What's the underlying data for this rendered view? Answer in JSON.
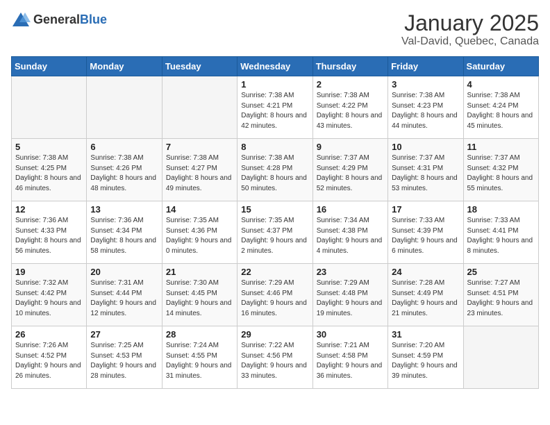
{
  "header": {
    "logo_general": "General",
    "logo_blue": "Blue",
    "month_title": "January 2025",
    "location": "Val-David, Quebec, Canada"
  },
  "days_of_week": [
    "Sunday",
    "Monday",
    "Tuesday",
    "Wednesday",
    "Thursday",
    "Friday",
    "Saturday"
  ],
  "weeks": [
    [
      {
        "day": "",
        "info": ""
      },
      {
        "day": "",
        "info": ""
      },
      {
        "day": "",
        "info": ""
      },
      {
        "day": "1",
        "info": "Sunrise: 7:38 AM\nSunset: 4:21 PM\nDaylight: 8 hours and 42 minutes."
      },
      {
        "day": "2",
        "info": "Sunrise: 7:38 AM\nSunset: 4:22 PM\nDaylight: 8 hours and 43 minutes."
      },
      {
        "day": "3",
        "info": "Sunrise: 7:38 AM\nSunset: 4:23 PM\nDaylight: 8 hours and 44 minutes."
      },
      {
        "day": "4",
        "info": "Sunrise: 7:38 AM\nSunset: 4:24 PM\nDaylight: 8 hours and 45 minutes."
      }
    ],
    [
      {
        "day": "5",
        "info": "Sunrise: 7:38 AM\nSunset: 4:25 PM\nDaylight: 8 hours and 46 minutes."
      },
      {
        "day": "6",
        "info": "Sunrise: 7:38 AM\nSunset: 4:26 PM\nDaylight: 8 hours and 48 minutes."
      },
      {
        "day": "7",
        "info": "Sunrise: 7:38 AM\nSunset: 4:27 PM\nDaylight: 8 hours and 49 minutes."
      },
      {
        "day": "8",
        "info": "Sunrise: 7:38 AM\nSunset: 4:28 PM\nDaylight: 8 hours and 50 minutes."
      },
      {
        "day": "9",
        "info": "Sunrise: 7:37 AM\nSunset: 4:29 PM\nDaylight: 8 hours and 52 minutes."
      },
      {
        "day": "10",
        "info": "Sunrise: 7:37 AM\nSunset: 4:31 PM\nDaylight: 8 hours and 53 minutes."
      },
      {
        "day": "11",
        "info": "Sunrise: 7:37 AM\nSunset: 4:32 PM\nDaylight: 8 hours and 55 minutes."
      }
    ],
    [
      {
        "day": "12",
        "info": "Sunrise: 7:36 AM\nSunset: 4:33 PM\nDaylight: 8 hours and 56 minutes."
      },
      {
        "day": "13",
        "info": "Sunrise: 7:36 AM\nSunset: 4:34 PM\nDaylight: 8 hours and 58 minutes."
      },
      {
        "day": "14",
        "info": "Sunrise: 7:35 AM\nSunset: 4:36 PM\nDaylight: 9 hours and 0 minutes."
      },
      {
        "day": "15",
        "info": "Sunrise: 7:35 AM\nSunset: 4:37 PM\nDaylight: 9 hours and 2 minutes."
      },
      {
        "day": "16",
        "info": "Sunrise: 7:34 AM\nSunset: 4:38 PM\nDaylight: 9 hours and 4 minutes."
      },
      {
        "day": "17",
        "info": "Sunrise: 7:33 AM\nSunset: 4:39 PM\nDaylight: 9 hours and 6 minutes."
      },
      {
        "day": "18",
        "info": "Sunrise: 7:33 AM\nSunset: 4:41 PM\nDaylight: 9 hours and 8 minutes."
      }
    ],
    [
      {
        "day": "19",
        "info": "Sunrise: 7:32 AM\nSunset: 4:42 PM\nDaylight: 9 hours and 10 minutes."
      },
      {
        "day": "20",
        "info": "Sunrise: 7:31 AM\nSunset: 4:44 PM\nDaylight: 9 hours and 12 minutes."
      },
      {
        "day": "21",
        "info": "Sunrise: 7:30 AM\nSunset: 4:45 PM\nDaylight: 9 hours and 14 minutes."
      },
      {
        "day": "22",
        "info": "Sunrise: 7:29 AM\nSunset: 4:46 PM\nDaylight: 9 hours and 16 minutes."
      },
      {
        "day": "23",
        "info": "Sunrise: 7:29 AM\nSunset: 4:48 PM\nDaylight: 9 hours and 19 minutes."
      },
      {
        "day": "24",
        "info": "Sunrise: 7:28 AM\nSunset: 4:49 PM\nDaylight: 9 hours and 21 minutes."
      },
      {
        "day": "25",
        "info": "Sunrise: 7:27 AM\nSunset: 4:51 PM\nDaylight: 9 hours and 23 minutes."
      }
    ],
    [
      {
        "day": "26",
        "info": "Sunrise: 7:26 AM\nSunset: 4:52 PM\nDaylight: 9 hours and 26 minutes."
      },
      {
        "day": "27",
        "info": "Sunrise: 7:25 AM\nSunset: 4:53 PM\nDaylight: 9 hours and 28 minutes."
      },
      {
        "day": "28",
        "info": "Sunrise: 7:24 AM\nSunset: 4:55 PM\nDaylight: 9 hours and 31 minutes."
      },
      {
        "day": "29",
        "info": "Sunrise: 7:22 AM\nSunset: 4:56 PM\nDaylight: 9 hours and 33 minutes."
      },
      {
        "day": "30",
        "info": "Sunrise: 7:21 AM\nSunset: 4:58 PM\nDaylight: 9 hours and 36 minutes."
      },
      {
        "day": "31",
        "info": "Sunrise: 7:20 AM\nSunset: 4:59 PM\nDaylight: 9 hours and 39 minutes."
      },
      {
        "day": "",
        "info": ""
      }
    ]
  ],
  "alt_rows": [
    1,
    3
  ]
}
